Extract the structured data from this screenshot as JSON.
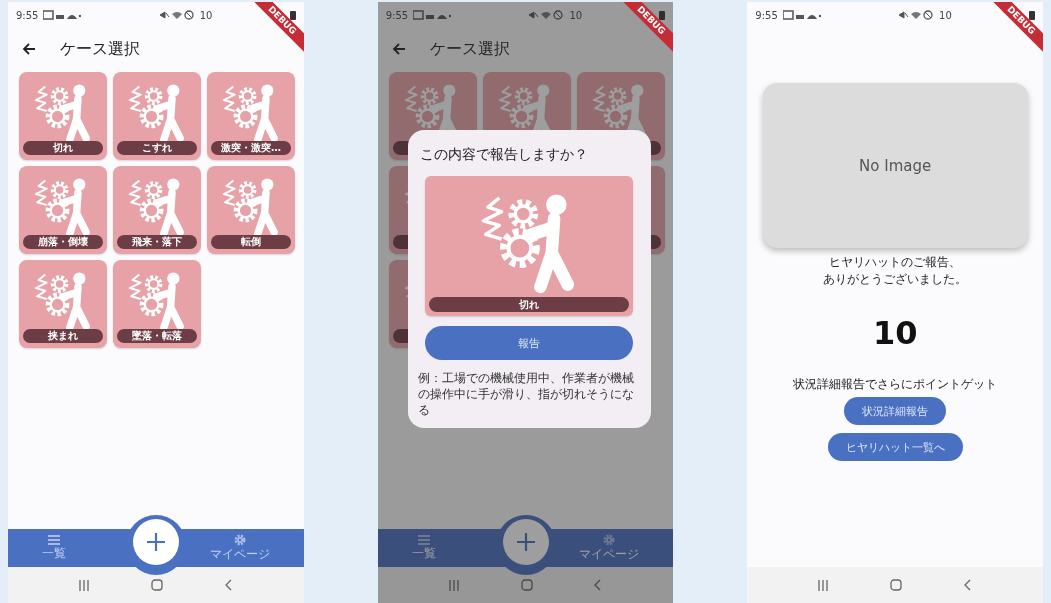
{
  "screens": [
    {
      "kind": "case_select",
      "status_time": "9:55",
      "battery": "10",
      "banner": "DEBUG",
      "title": "ケース選択",
      "cases": [
        {
          "label": "切れ"
        },
        {
          "label": "こすれ"
        },
        {
          "label": "激突・激突…"
        },
        {
          "label": "崩落・倒壊"
        },
        {
          "label": "飛来・落下"
        },
        {
          "label": "転倒"
        },
        {
          "label": "挟まれ"
        },
        {
          "label": "墜落・転落"
        }
      ],
      "nav": [
        {
          "kind": "list",
          "label": "一覧"
        },
        {
          "kind": "settings",
          "label": "マイページ"
        }
      ]
    },
    {
      "kind": "confirm_dialog",
      "status_time": "9:55",
      "battery": "10",
      "banner": "DEBUG",
      "title": "ケース選択",
      "nav": [
        {
          "kind": "list",
          "label": "一覧"
        },
        {
          "kind": "settings",
          "label": "マイページ"
        }
      ],
      "dialog": {
        "title": "この内容で報告しますか？",
        "case": "切れ",
        "button": "報告",
        "example": "例：工場での機械使用中、作業者が機械の操作中に手が滑り、指が切れそうになる"
      }
    },
    {
      "kind": "thanks",
      "status_time": "9:55",
      "battery": "10",
      "banner": "DEBUG",
      "image_placeholder": "No Image",
      "thanks": [
        "ヒヤリハットのご報告、",
        "ありがとうございました。"
      ],
      "points": "10",
      "prompt": "状況詳細報告でさらにポイントゲット",
      "buttons": [
        "状況詳細報告",
        "ヒヤリハット一覧へ"
      ]
    }
  ]
}
